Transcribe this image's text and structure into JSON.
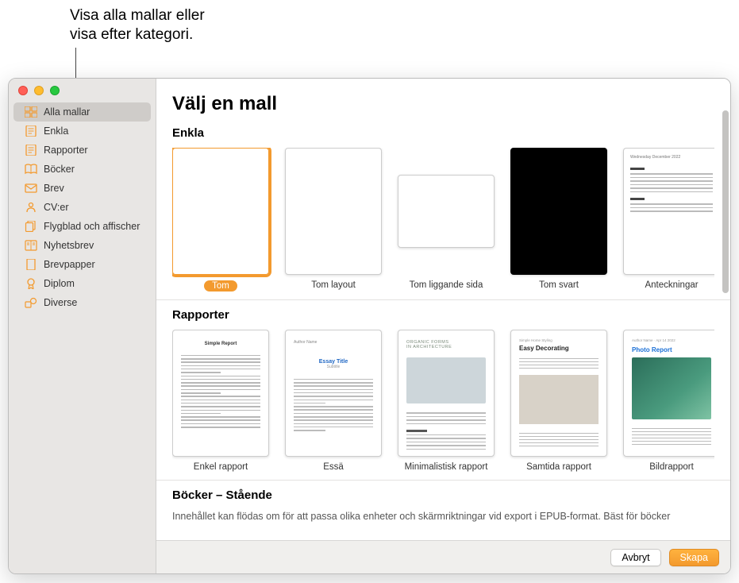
{
  "callout": "Visa alla mallar eller\nvisa efter kategori.",
  "sidebar": {
    "items": [
      {
        "label": "Alla mallar",
        "icon": "grid"
      },
      {
        "label": "Enkla",
        "icon": "page-lines"
      },
      {
        "label": "Rapporter",
        "icon": "page-lines"
      },
      {
        "label": "Böcker",
        "icon": "book"
      },
      {
        "label": "Brev",
        "icon": "envelope"
      },
      {
        "label": "CV:er",
        "icon": "person"
      },
      {
        "label": "Flygblad och affischer",
        "icon": "pages"
      },
      {
        "label": "Nyhetsbrev",
        "icon": "columns"
      },
      {
        "label": "Brevpapper",
        "icon": "page"
      },
      {
        "label": "Diplom",
        "icon": "ribbon"
      },
      {
        "label": "Diverse",
        "icon": "shapes"
      }
    ],
    "selected_index": 0
  },
  "main": {
    "title": "Välj en mall",
    "sections": [
      {
        "heading": "Enkla",
        "templates": [
          {
            "label": "Tom",
            "kind": "blank",
            "selected": true
          },
          {
            "label": "Tom layout",
            "kind": "blank"
          },
          {
            "label": "Tom liggande sida",
            "kind": "blank-landscape"
          },
          {
            "label": "Tom svart",
            "kind": "black"
          },
          {
            "label": "Anteckningar",
            "kind": "notes"
          }
        ]
      },
      {
        "heading": "Rapporter",
        "templates": [
          {
            "label": "Enkel rapport",
            "kind": "simple-report"
          },
          {
            "label": "Essä",
            "kind": "essay"
          },
          {
            "label": "Minimalistisk rapport",
            "kind": "minimal-report"
          },
          {
            "label": "Samtida rapport",
            "kind": "contemporary-report"
          },
          {
            "label": "Bildrapport",
            "kind": "photo-report"
          }
        ]
      },
      {
        "heading": "Böcker – Stående",
        "description": "Innehållet kan flödas om för att passa olika enheter och skärmriktningar vid export i EPUB-format. Bäst för böcker",
        "templates": []
      }
    ]
  },
  "footer": {
    "cancel": "Avbryt",
    "create": "Skapa"
  },
  "colors": {
    "accent": "#f39a2e"
  }
}
